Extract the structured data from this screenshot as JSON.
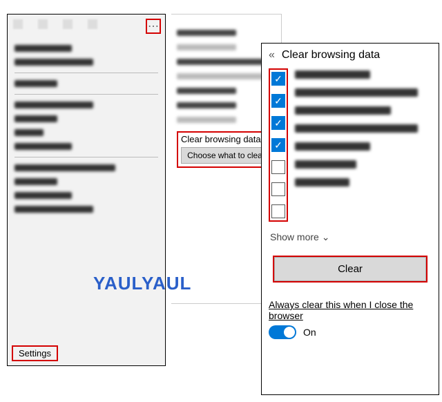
{
  "menu": {
    "settings_label": "Settings"
  },
  "mid": {
    "section_label": "Clear browsing data",
    "choose_label": "Choose what to clear"
  },
  "cbd": {
    "title": "Clear browsing data",
    "checks": [
      {
        "checked": true
      },
      {
        "checked": true
      },
      {
        "checked": true
      },
      {
        "checked": true
      },
      {
        "checked": false
      },
      {
        "checked": false
      },
      {
        "checked": false
      }
    ],
    "show_more": "Show more",
    "clear_label": "Clear",
    "always_label": "Always clear this when I close the browser",
    "toggle_label": "On",
    "toggle_on": true
  },
  "watermark": "YAULYAUL",
  "highlight_color": "#d40000",
  "accent_color": "#0078d7"
}
